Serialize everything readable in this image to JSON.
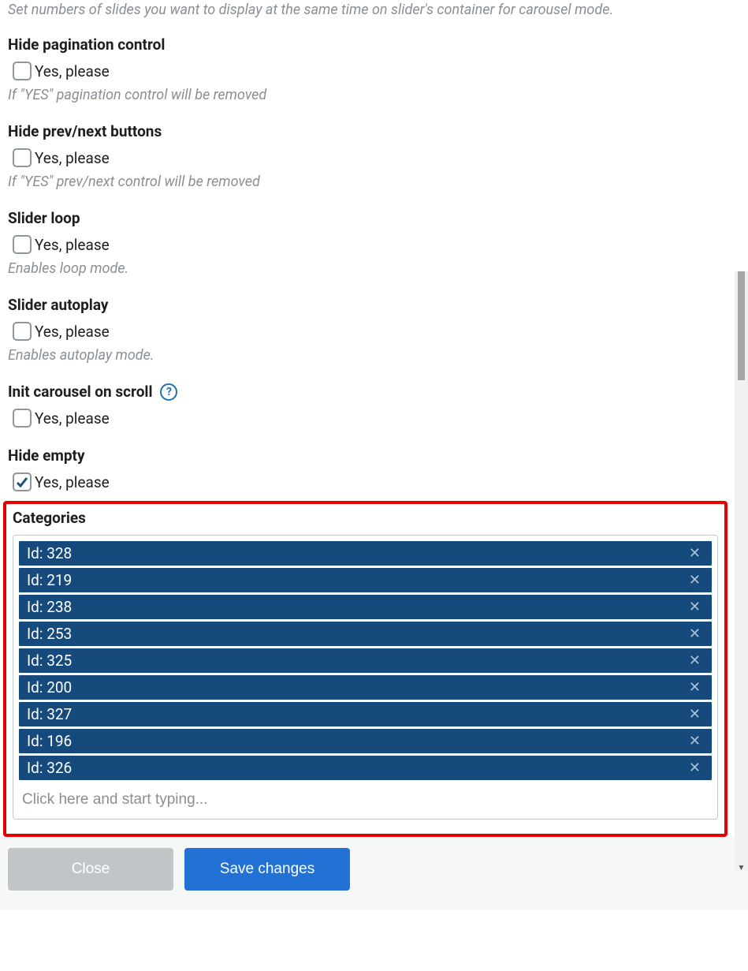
{
  "intro": "Set numbers of slides you want to display at the same time on slider's container for carousel mode.",
  "sections": {
    "hidePagination": {
      "title": "Hide pagination control",
      "checkboxLabel": "Yes, please",
      "hint": "If \"YES\" pagination control will be removed",
      "checked": false
    },
    "hidePrevNext": {
      "title": "Hide prev/next buttons",
      "checkboxLabel": "Yes, please",
      "hint": "If \"YES\" prev/next control will be removed",
      "checked": false
    },
    "sliderLoop": {
      "title": "Slider loop",
      "checkboxLabel": "Yes, please",
      "hint": "Enables loop mode.",
      "checked": false
    },
    "sliderAutoplay": {
      "title": "Slider autoplay",
      "checkboxLabel": "Yes, please",
      "hint": "Enables autoplay mode.",
      "checked": false
    },
    "initCarousel": {
      "title": "Init carousel on scroll",
      "checkboxLabel": "Yes, please",
      "checked": false,
      "helpIcon": "?"
    },
    "hideEmpty": {
      "title": "Hide empty",
      "checkboxLabel": "Yes, please",
      "checked": true
    }
  },
  "categories": {
    "title": "Categories",
    "items": [
      "Id: 328",
      "Id: 219",
      "Id: 238",
      "Id: 253",
      "Id: 325",
      "Id: 200",
      "Id: 327",
      "Id: 196",
      "Id: 326"
    ],
    "inputPlaceholder": "Click here and start typing..."
  },
  "buttons": {
    "close": "Close",
    "save": "Save changes"
  }
}
